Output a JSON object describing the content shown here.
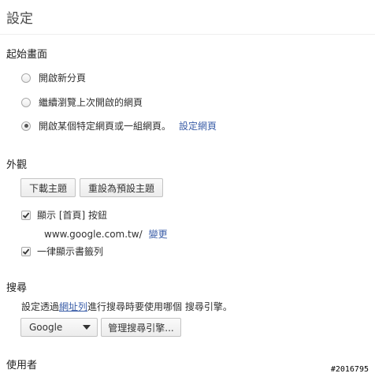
{
  "page": {
    "title": "設定"
  },
  "startup": {
    "heading": "起始畫面",
    "options": [
      {
        "label": "開啟新分頁",
        "checked": false
      },
      {
        "label": "繼續瀏覽上次開啟的網頁",
        "checked": false
      },
      {
        "label": "開啟某個特定網頁或一組網頁。",
        "checked": true
      }
    ],
    "set_pages_link": "設定網頁"
  },
  "appearance": {
    "heading": "外觀",
    "get_themes_button": "下載主題",
    "reset_theme_button": "重設為預設主題",
    "show_home_label": "顯示 [首頁] 按鈕",
    "home_url": "www.google.com.tw/",
    "change_link": "變更",
    "show_bookmarks_label": "一律顯示書籤列"
  },
  "search": {
    "heading": "搜尋",
    "desc_prefix": "設定透過",
    "desc_link": "網址列",
    "desc_suffix": "進行搜尋時要使用哪個 搜尋引擎。",
    "engine_selected": "Google",
    "manage_button": "管理搜尋引擎..."
  },
  "users": {
    "heading": "使用者"
  },
  "watermark": "#2016795"
}
